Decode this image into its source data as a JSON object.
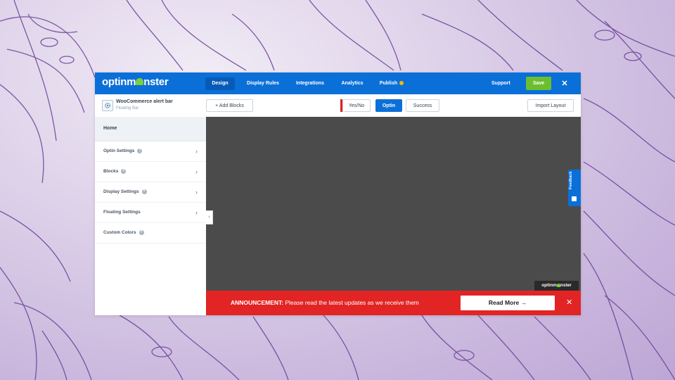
{
  "brand": {
    "logo_text_pre": "optinm",
    "logo_text_post": "nster"
  },
  "topnav": {
    "items": [
      {
        "label": "Design",
        "active": true
      },
      {
        "label": "Display Rules",
        "active": false
      },
      {
        "label": "Integrations",
        "active": false
      },
      {
        "label": "Analytics",
        "active": false
      },
      {
        "label": "Publish",
        "active": false
      }
    ],
    "support_label": "Support",
    "save_label": "Save",
    "close_label": "✕"
  },
  "toolbar": {
    "campaign_name": "WooCommerce alert bar",
    "campaign_type": "Floating Bar",
    "add_blocks_label": "+ Add Blocks",
    "views": [
      {
        "label": "Yes/No",
        "active": false
      },
      {
        "label": "Optin",
        "active": true
      },
      {
        "label": "Success",
        "active": false
      }
    ],
    "import_label": "Import Layout"
  },
  "sidebar": {
    "home_label": "Home",
    "items": [
      {
        "label": "Optin Settings",
        "has_help": true
      },
      {
        "label": "Blocks",
        "has_help": true
      },
      {
        "label": "Display Settings",
        "has_help": true
      },
      {
        "label": "Floating Settings",
        "has_help": false
      },
      {
        "label": "Custom Colors",
        "has_help": true
      }
    ],
    "collapse_label": "‹"
  },
  "canvas": {
    "feedback_label": "Feedback",
    "badge_pre": "optinm",
    "badge_post": "nster"
  },
  "announcement": {
    "bold_label": "ANNOUNCEMENT:",
    "message": "Please read the latest updates as we receive them",
    "button_label": "Read More →",
    "close_label": "✕"
  },
  "colors": {
    "brand_blue": "#0b6fd8",
    "save_green": "#6cbe2e",
    "announce_red": "#e22424",
    "canvas_gray": "#4b4b4b"
  },
  "icons": [
    "gear-icon",
    "help-icon",
    "chevron-right-icon",
    "close-icon",
    "feedback-icon"
  ]
}
